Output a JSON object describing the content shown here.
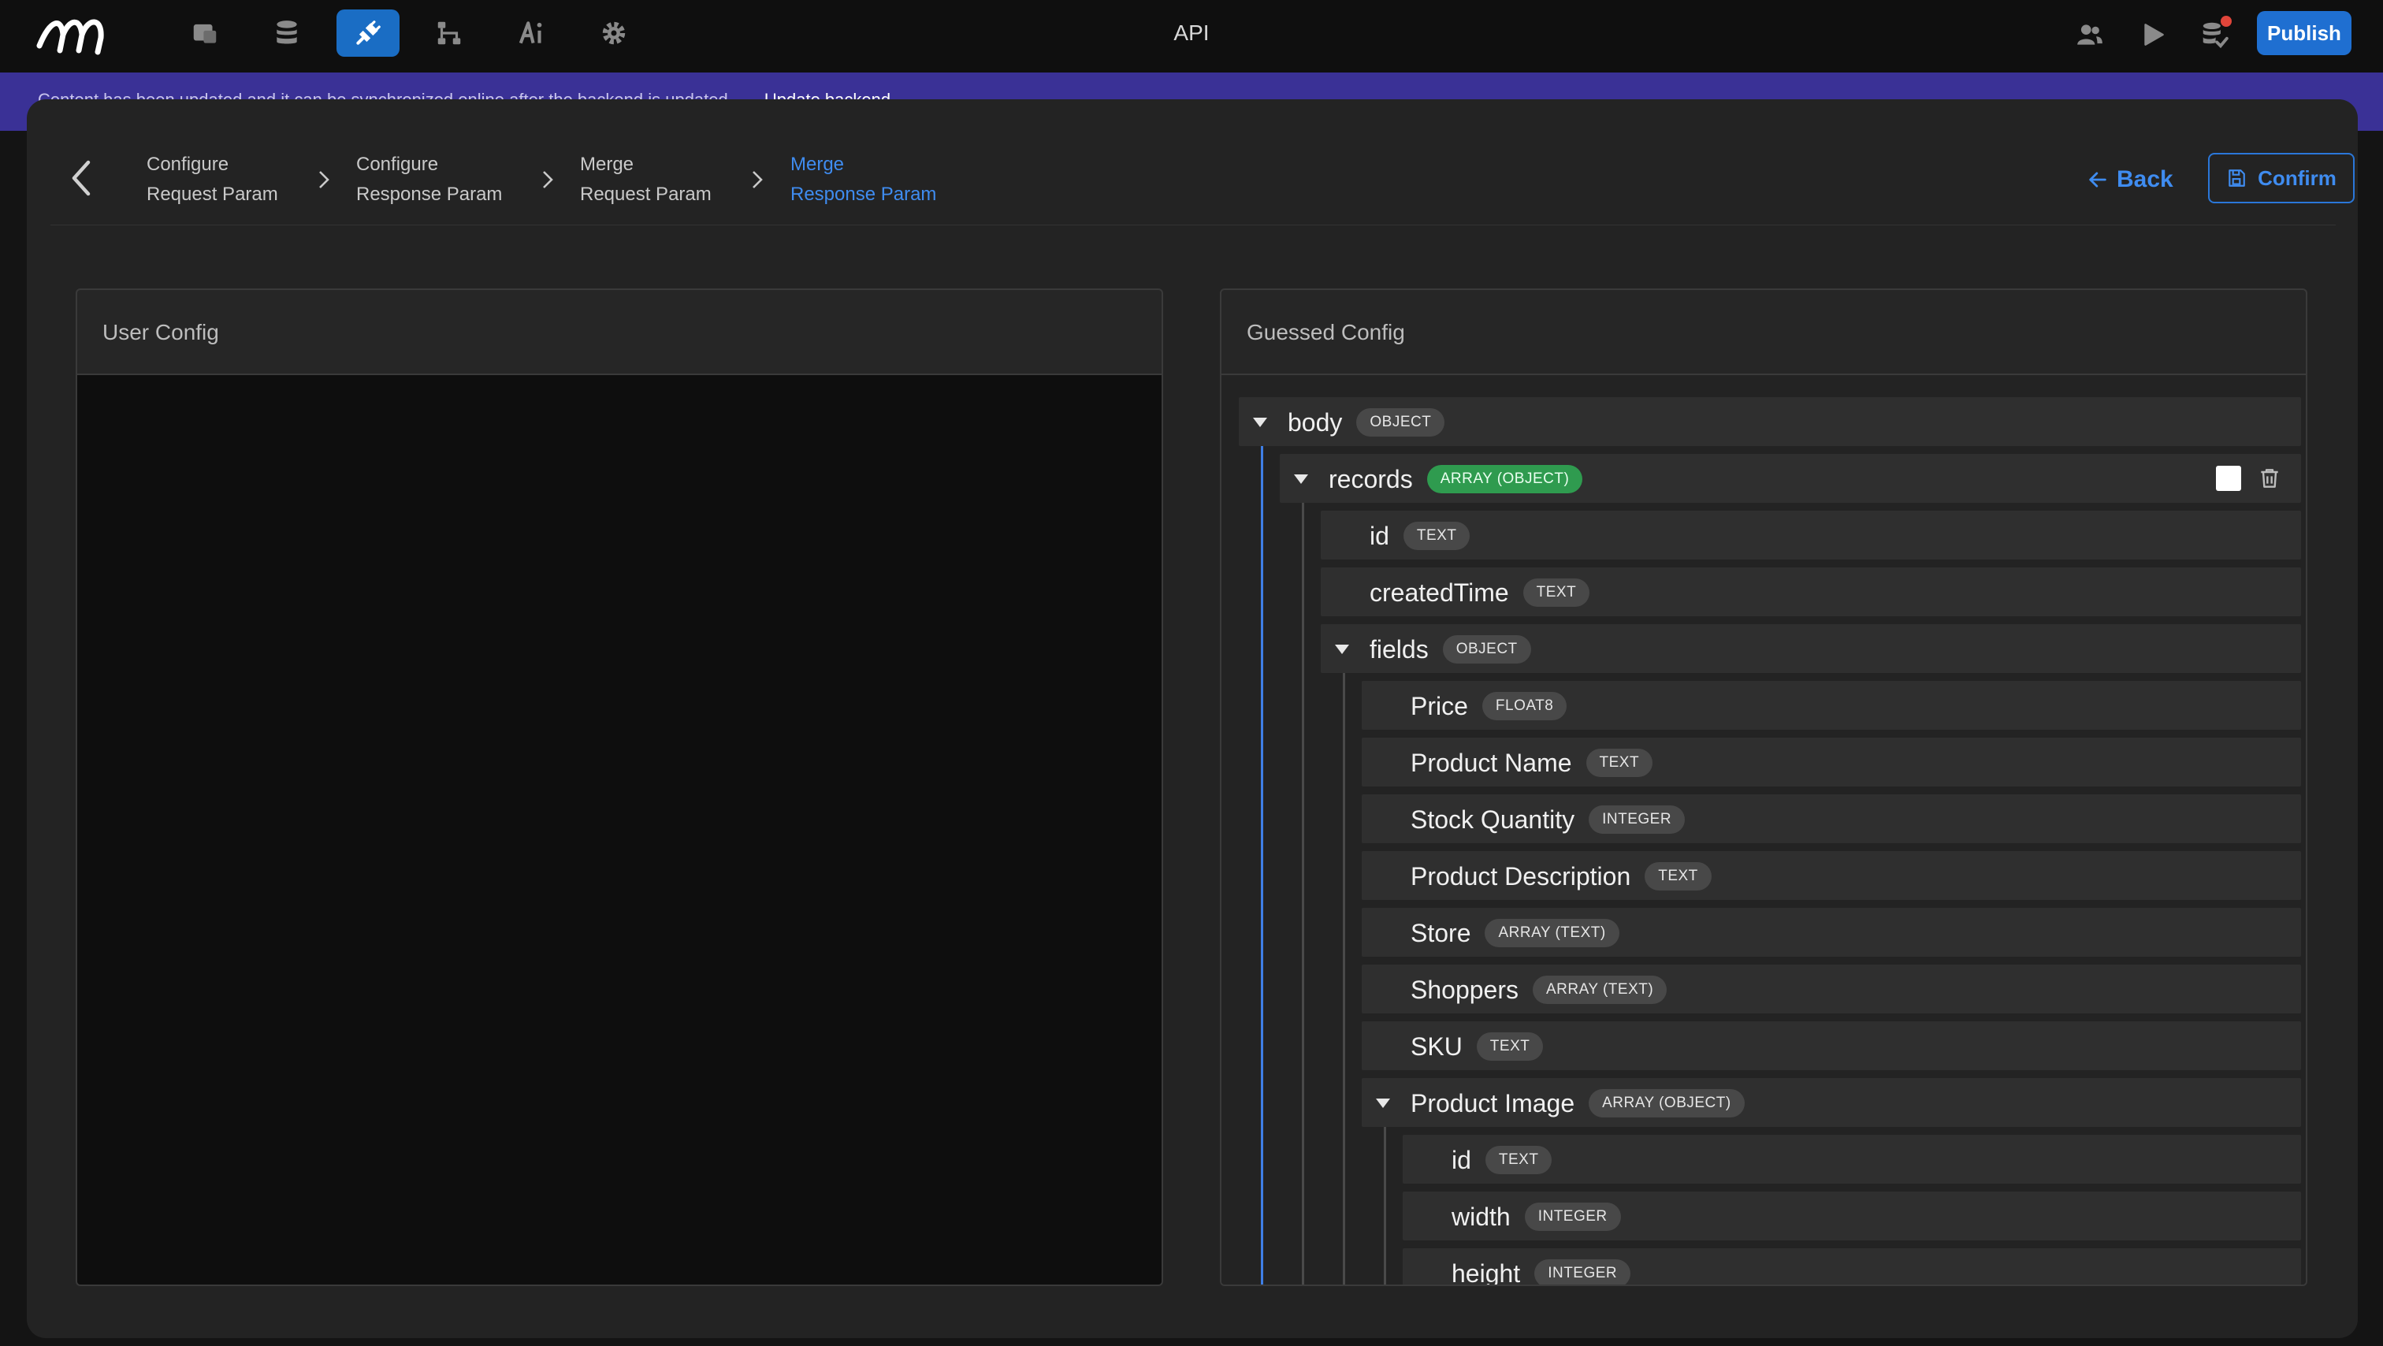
{
  "app": {
    "title": "API",
    "publish_label": "Publish"
  },
  "nav": {
    "items": [
      {
        "icon": "pages-icon",
        "active": false
      },
      {
        "icon": "database-icon",
        "active": false
      },
      {
        "icon": "api-plug-icon",
        "active": true
      },
      {
        "icon": "workflow-icon",
        "active": false
      },
      {
        "icon": "ai-icon",
        "active": false
      },
      {
        "icon": "settings-gear-icon",
        "active": false
      }
    ],
    "right_icons": [
      "users-icon",
      "play-icon",
      "database-status-icon"
    ]
  },
  "banner": {
    "text": "Content has been updated and it can be synchronized online after the backend is updated.",
    "link": "Update backend"
  },
  "stepper": {
    "steps": [
      {
        "line1": "Configure",
        "line2": "Request Param",
        "active": false
      },
      {
        "line1": "Configure",
        "line2": "Response Param",
        "active": false
      },
      {
        "line1": "Merge",
        "line2": "Request Param",
        "active": false
      },
      {
        "line1": "Merge",
        "line2": "Response Param",
        "active": true
      }
    ],
    "back_label": "Back",
    "confirm_label": "Confirm"
  },
  "panels": {
    "user_config_title": "User Config",
    "guessed_config_title": "Guessed Config"
  },
  "tree": [
    {
      "name": "body",
      "type": "OBJECT",
      "depth": 0,
      "expanded": true
    },
    {
      "name": "records",
      "type": "ARRAY (OBJECT)",
      "depth": 1,
      "expanded": true,
      "highlight": true
    },
    {
      "name": "id",
      "type": "TEXT",
      "depth": 2
    },
    {
      "name": "createdTime",
      "type": "TEXT",
      "depth": 2
    },
    {
      "name": "fields",
      "type": "OBJECT",
      "depth": 2,
      "expanded": true
    },
    {
      "name": "Price",
      "type": "FLOAT8",
      "depth": 3
    },
    {
      "name": "Product Name",
      "type": "TEXT",
      "depth": 3
    },
    {
      "name": "Stock Quantity",
      "type": "INTEGER",
      "depth": 3
    },
    {
      "name": "Product Description",
      "type": "TEXT",
      "depth": 3
    },
    {
      "name": "Store",
      "type": "ARRAY (TEXT)",
      "depth": 3
    },
    {
      "name": "Shoppers",
      "type": "ARRAY (TEXT)",
      "depth": 3
    },
    {
      "name": "SKU",
      "type": "TEXT",
      "depth": 3
    },
    {
      "name": "Product Image",
      "type": "ARRAY (OBJECT)",
      "depth": 3,
      "expanded": true
    },
    {
      "name": "id",
      "type": "TEXT",
      "depth": 4
    },
    {
      "name": "width",
      "type": "INTEGER",
      "depth": 4
    },
    {
      "name": "height",
      "type": "INTEGER",
      "depth": 4
    }
  ],
  "colors": {
    "accent": "#3f8cf0",
    "publish": "#1f6fd1",
    "banner": "#3a3196",
    "array_object_badge": "#2f9b4f"
  }
}
